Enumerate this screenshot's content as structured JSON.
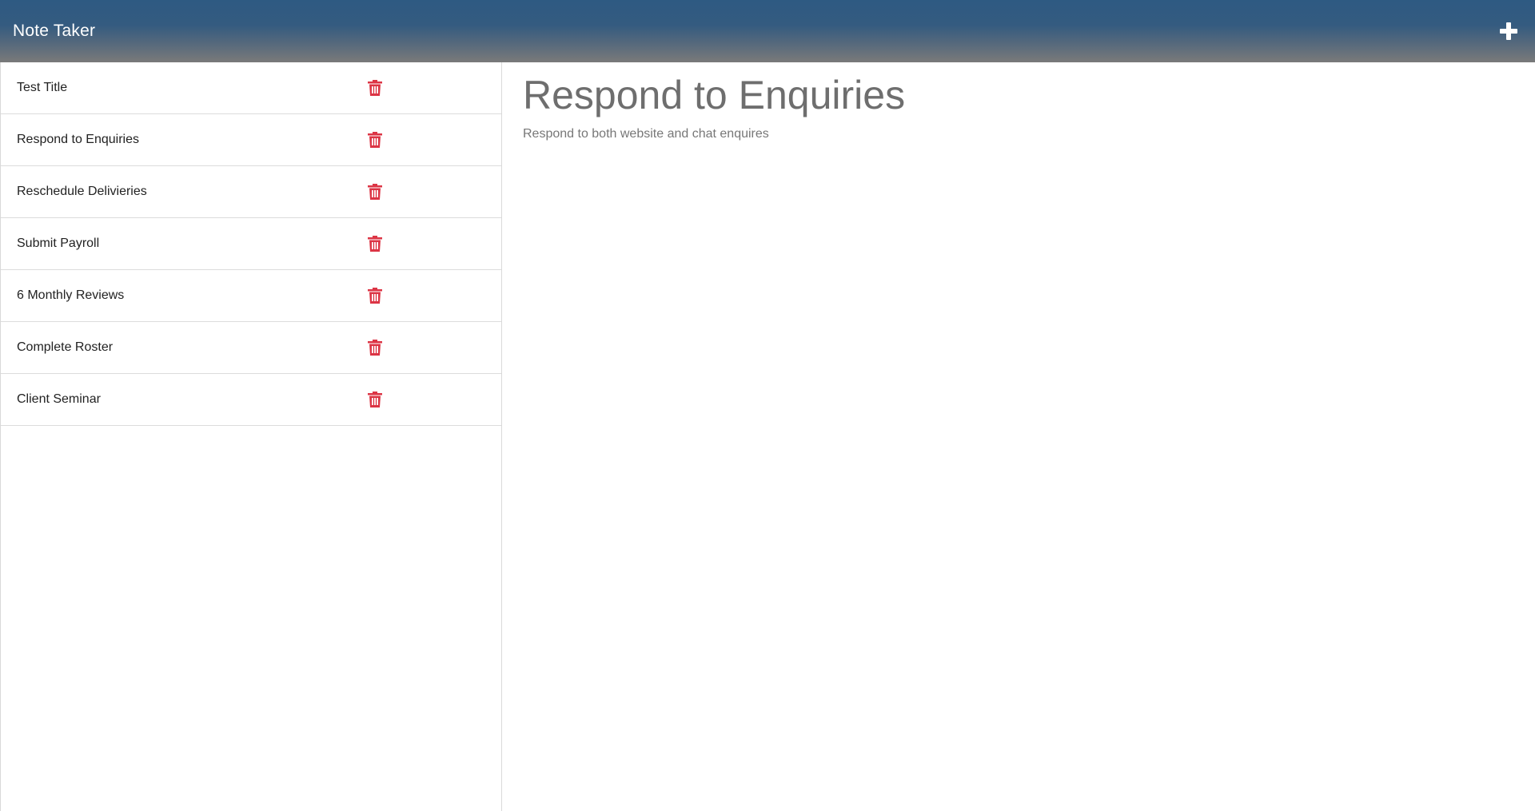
{
  "navbar": {
    "title": "Note Taker",
    "new_note_icon": "plus-icon"
  },
  "notes": [
    {
      "title": "Test Title",
      "delete_icon": "trash-icon"
    },
    {
      "title": "Respond to Enquiries",
      "delete_icon": "trash-icon"
    },
    {
      "title": "Reschedule Delivieries",
      "delete_icon": "trash-icon"
    },
    {
      "title": "Submit Payroll",
      "delete_icon": "trash-icon"
    },
    {
      "title": "6 Monthly Reviews",
      "delete_icon": "trash-icon"
    },
    {
      "title": "Complete Roster",
      "delete_icon": "trash-icon"
    },
    {
      "title": "Client Seminar",
      "delete_icon": "trash-icon"
    }
  ],
  "active_note": {
    "title": "Respond to Enquiries",
    "text": "Respond to both website and chat enquires"
  },
  "colors": {
    "navbar_top": "#2e5a82",
    "navbar_bottom": "#7a7a7a",
    "delete_icon": "#dc3545"
  }
}
